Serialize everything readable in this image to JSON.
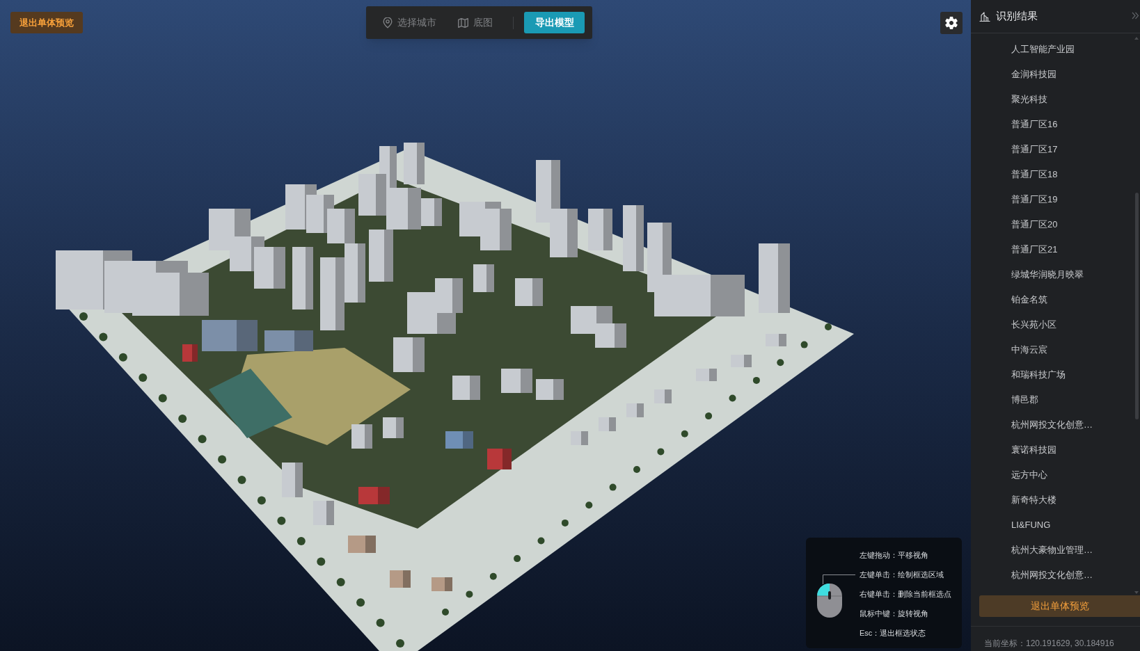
{
  "exit_preview_button": {
    "label": "退出单体预览"
  },
  "toolbar": {
    "items": [
      {
        "kind": "location",
        "label": "选择城市"
      },
      {
        "kind": "map",
        "label": "底图"
      }
    ],
    "export_button": {
      "label": "导出模型"
    }
  },
  "side_panel": {
    "title": "识别结果",
    "items": [
      "人工智能产业园",
      "金润科技园",
      "聚光科技",
      "普通厂区16",
      "普通厂区17",
      "普通厂区18",
      "普通厂区19",
      "普通厂区20",
      "普通厂区21",
      "绿城华润晓月映翠",
      "铂金名筑",
      "长兴苑小区",
      "中海云宸",
      "和瑞科技广场",
      "博邑郡",
      "杭州网投文化创意…",
      "寰诺科技园",
      "远方中心",
      "新奇特大楼",
      "LI&FUNG",
      "杭州大豪物业管理…",
      "杭州网投文化创意…"
    ],
    "exit_button": {
      "label": "退出单体预览"
    },
    "coordinates": "当前坐标：120.191629, 30.184916"
  },
  "help": {
    "lines": [
      "左键拖动：平移视角",
      "左键单击：绘制框选区域",
      "右键单击：删除当前框选点",
      "鼠标中键：旋转视角",
      "Esc：退出框选状态"
    ]
  }
}
